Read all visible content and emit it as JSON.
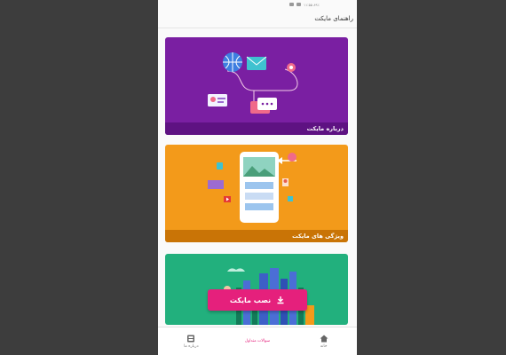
{
  "status_bar": {
    "text": "۱۱:۵۵ ۸۹٪"
  },
  "app_bar": {
    "title": "راهنمای مایکت"
  },
  "cards": [
    {
      "caption": "درباره مایکت",
      "color": "#7a1fa2"
    },
    {
      "caption": "ویژگی های مایکت",
      "color": "#f39a1a"
    },
    {
      "button_label": "نصب مایکت",
      "color": "#22b07d"
    }
  ],
  "bottom_nav": {
    "items": [
      {
        "label": "خانه",
        "icon": "home-icon",
        "active": false
      },
      {
        "label": "سوالات متداول",
        "icon": "",
        "active": true
      },
      {
        "label": "درباره ما",
        "icon": "info-icon",
        "active": false
      }
    ]
  },
  "colors": {
    "accent": "#e5207c"
  }
}
